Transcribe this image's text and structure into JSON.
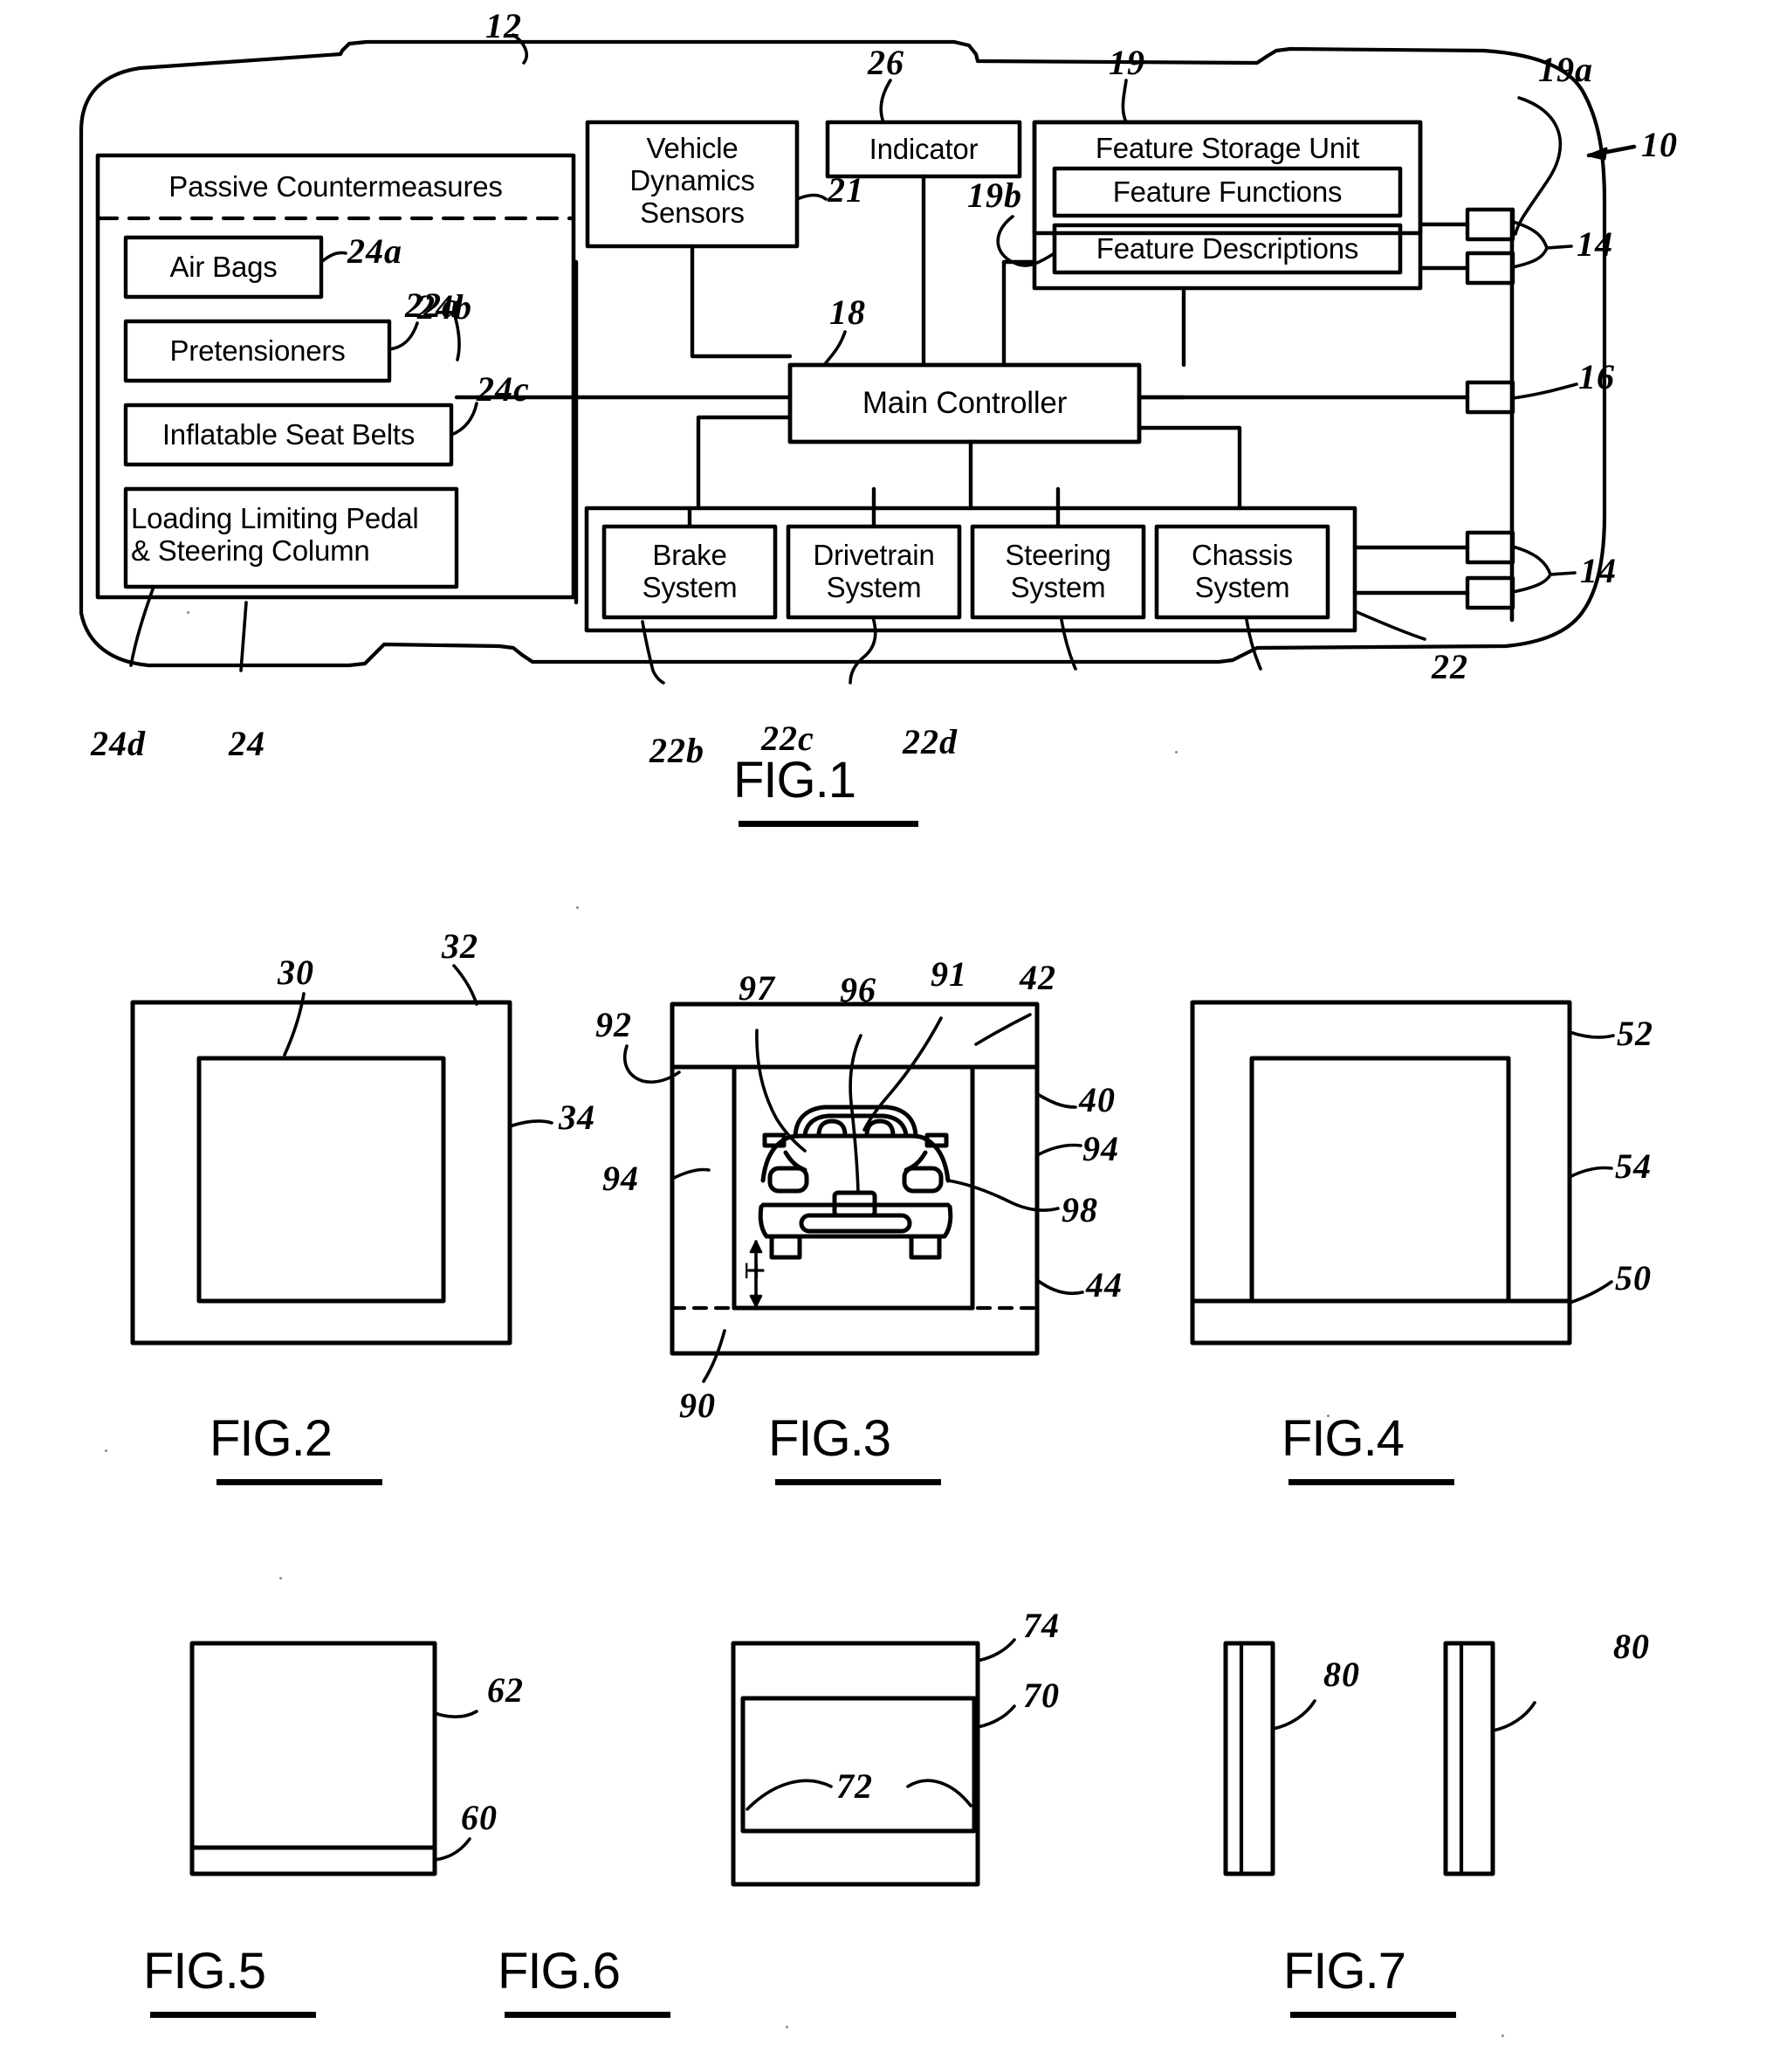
{
  "document": {
    "kind": "patent-drawing-sheet",
    "figures": [
      "FIG.1",
      "FIG.2",
      "FIG.3",
      "FIG.4",
      "FIG.5",
      "FIG.6",
      "FIG.7"
    ]
  },
  "fig1": {
    "caption": "FIG.1",
    "boxes": {
      "passive_countermeasures": "Passive Countermeasures",
      "air_bags": "Air Bags",
      "pretensioners": "Pretensioners",
      "inflatable_seat_belts": "Inflatable Seat Belts",
      "loading_limiting": "Loading Limiting Pedal\n& Steering Column",
      "vehicle_dynamics_sensors": "Vehicle\nDynamics\nSensors",
      "indicator": "Indicator",
      "feature_storage_unit": "Feature Storage Unit",
      "feature_functions": "Feature Functions",
      "feature_descriptions": "Feature Descriptions",
      "main_controller": "Main Controller",
      "brake_system": "Brake\nSystem",
      "drivetrain_system": "Drivetrain\nSystem",
      "steering_system": "Steering\nSystem",
      "chassis_system": "Chassis\nSystem"
    },
    "refnums": {
      "n12": "12",
      "n26": "26",
      "n19": "19",
      "n19a": "19a",
      "n19b": "19b",
      "n10": "10",
      "n21": "21",
      "n18": "18",
      "n14_top": "14",
      "n16": "16",
      "n14_bottom": "14",
      "n24a": "24a",
      "n24b": "24b",
      "n24c": "24c",
      "n24d": "24d",
      "n24": "24",
      "n22a": "22a",
      "n22b": "22b",
      "n22c": "22c",
      "n22d": "22d",
      "n22": "22"
    }
  },
  "fig2": {
    "caption": "FIG.2",
    "refnums": {
      "n30": "30",
      "n32": "32",
      "n34": "34"
    }
  },
  "fig3": {
    "caption": "FIG.3",
    "height_label": "H",
    "refnums": {
      "n97": "97",
      "n96": "96",
      "n91": "91",
      "n42": "42",
      "n92": "92",
      "n40": "40",
      "n94_right": "94",
      "n94_left": "94",
      "n98": "98",
      "n44": "44",
      "n90": "90"
    }
  },
  "fig4": {
    "caption": "FIG.4",
    "refnums": {
      "n52": "52",
      "n54": "54",
      "n50": "50"
    }
  },
  "fig5": {
    "caption": "FIG.5",
    "refnums": {
      "n62": "62",
      "n60": "60"
    }
  },
  "fig6": {
    "caption": "FIG.6",
    "refnums": {
      "n74": "74",
      "n70": "70",
      "n72": "72"
    }
  },
  "fig7": {
    "caption": "FIG.7",
    "refnums": {
      "n80_left": "80",
      "n80_right": "80"
    }
  }
}
